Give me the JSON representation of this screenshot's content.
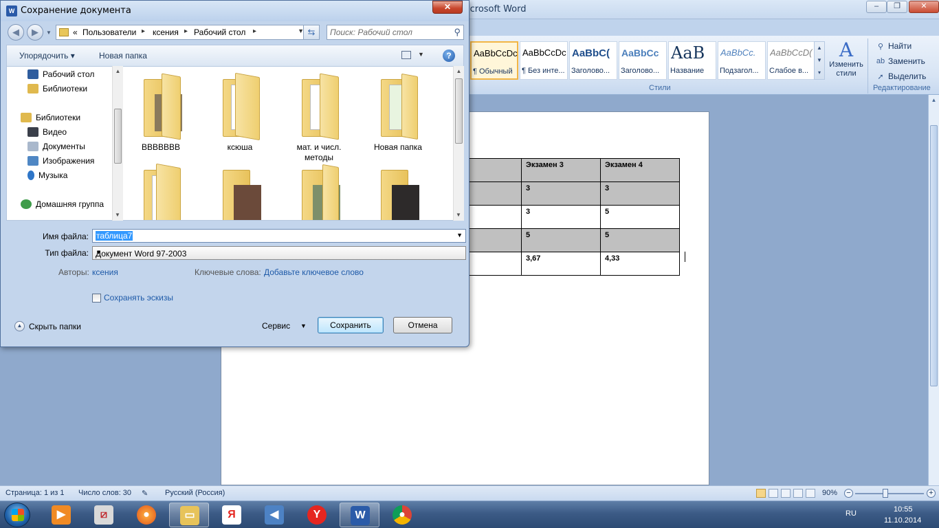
{
  "word": {
    "title": "icrosoft Word",
    "styles": [
      {
        "sample": "AaBbCcDc",
        "name": "¶ Обычный",
        "active": true
      },
      {
        "sample": "AaBbCcDc",
        "name": "¶ Без инте..."
      },
      {
        "sample": "AaBbC(",
        "name": "Заголово..."
      },
      {
        "sample": "AaBbCc",
        "name": "Заголово..."
      },
      {
        "sample": "AaB",
        "name": "Название"
      },
      {
        "sample": "AaBbCc.",
        "name": "Подзагол..."
      },
      {
        "sample": "AaBbCcD(",
        "name": "Слабое в..."
      }
    ],
    "change_styles_label": "Изменить стили",
    "styles_group_label": "Стили",
    "edit_group_label": "Редактирование",
    "find_label": "Найти",
    "replace_label": "Заменить",
    "select_label": "Выделить",
    "table": {
      "header": [
        "мен 2",
        "Экзамен 3",
        "Экзамен 4"
      ],
      "rows": [
        [
          "",
          "3",
          "3"
        ],
        [
          "",
          "3",
          "5"
        ],
        [
          "",
          "5",
          "5"
        ],
        [
          "",
          "3,67",
          "4,33"
        ]
      ]
    },
    "status": {
      "page": "Страница: 1 из 1",
      "words": "Число слов: 30",
      "language": "Русский (Россия)",
      "zoom": "90%"
    }
  },
  "dialog": {
    "title": "Сохранение документа",
    "close_label": "✕",
    "address": {
      "prefix": "«",
      "crumbs": [
        "Пользователи",
        "ксения",
        "Рабочий стол"
      ]
    },
    "search_placeholder": "Поиск: Рабочий стол",
    "toolbar": {
      "organize": "Упорядочить ▾",
      "new_folder": "Новая папка"
    },
    "nav": [
      {
        "label": "Рабочий стол",
        "icon": "desktop-icon",
        "color": "#2f5d9e"
      },
      {
        "label": "Библиотеки",
        "icon": "library-icon",
        "color": "#e0b94e"
      },
      {
        "label": "Библиотеки",
        "icon": "library-icon",
        "color": "#e0b94e"
      },
      {
        "label": "Видео",
        "icon": "video-icon",
        "color": "#3a3f4a"
      },
      {
        "label": "Документы",
        "icon": "documents-icon",
        "color": "#a9b8cc"
      },
      {
        "label": "Изображения",
        "icon": "pictures-icon",
        "color": "#4f87c4"
      },
      {
        "label": "Музыка",
        "icon": "music-icon",
        "color": "#2f76c8"
      },
      {
        "label": "Домашняя группа",
        "icon": "homegroup-icon",
        "color": "#3f9c4a"
      }
    ],
    "folders": [
      {
        "label": "BBBBBBB",
        "photo": "#8a7a5c"
      },
      {
        "label": "ксюша",
        "photo": "#9fb6d2"
      },
      {
        "label": "мат. и числ. методы",
        "photo": "#ffffff"
      },
      {
        "label": "Новая папка",
        "photo": "#7cb86a"
      },
      {
        "label": "",
        "photo": "#9fb6d2"
      },
      {
        "label": "",
        "photo": "#6b4a3a"
      },
      {
        "label": "",
        "photo": "#7d8f6a"
      },
      {
        "label": "",
        "photo": "#2d2a2a"
      }
    ],
    "form": {
      "filename_label": "Имя файла:",
      "filename_value": "таблица7",
      "filetype_label": "Тип файла:",
      "filetype_value": "Документ Word 97-2003",
      "authors_label": "Авторы:",
      "authors_value": "ксения",
      "keywords_label": "Ключевые слова:",
      "keywords_value": "Добавьте ключевое слово",
      "thumbnails_label": "Сохранять эскизы",
      "hide_folders_label": "Скрыть папки",
      "service_label": "Сервис",
      "save_label": "Сохранить",
      "cancel_label": "Отмена"
    }
  },
  "taskbar": {
    "lang": "RU",
    "time": "10:55",
    "date": "11.10.2014"
  }
}
